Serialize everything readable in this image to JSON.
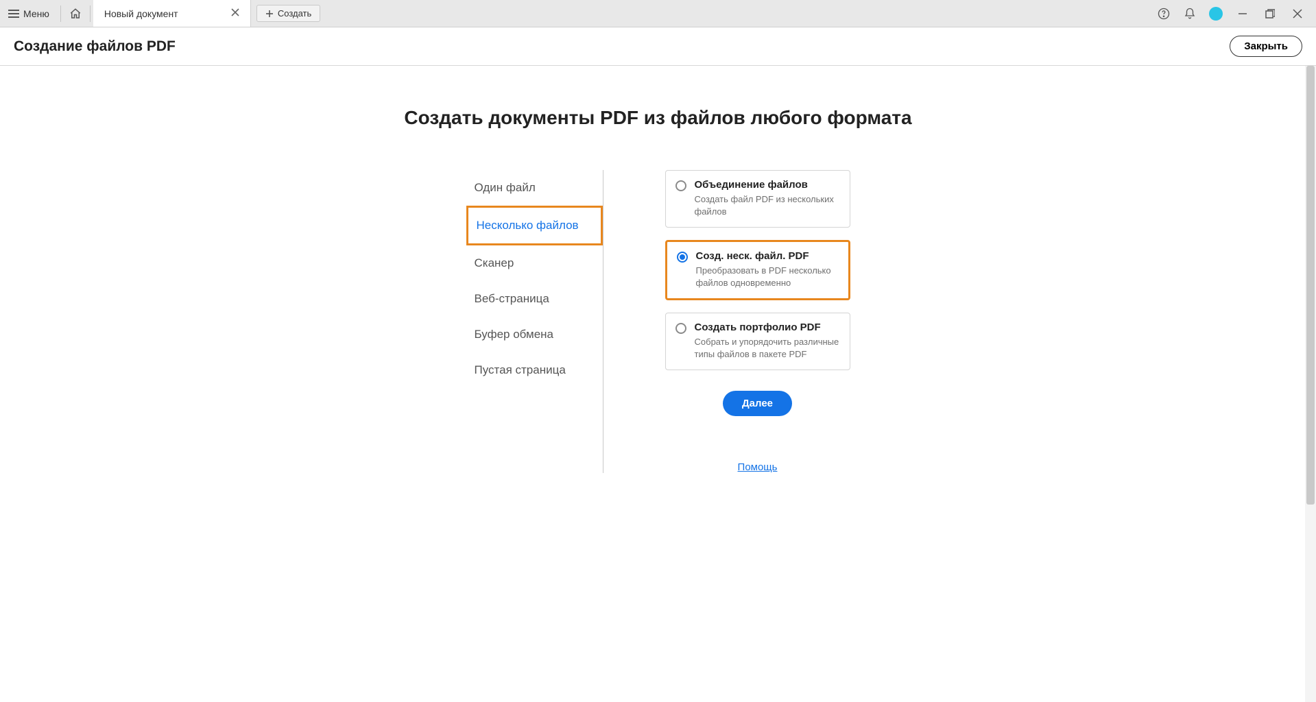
{
  "toolbar": {
    "menu_label": "Меню",
    "tab_label": "Новый документ",
    "create_label": "Создать"
  },
  "header": {
    "title": "Создание файлов PDF",
    "close_label": "Закрыть"
  },
  "main": {
    "title": "Создать документы PDF из файлов любого формата",
    "sidenav": [
      "Один файл",
      "Несколько файлов",
      "Сканер",
      "Веб-страница",
      "Буфер обмена",
      "Пустая страница"
    ],
    "sidenav_active_index": 1,
    "options": [
      {
        "title": "Объединение файлов",
        "desc": "Создать файл PDF из нескольких файлов",
        "selected": false
      },
      {
        "title": "Созд. неск. файл. PDF",
        "desc": "Преобразовать в PDF несколько файлов одновременно",
        "selected": true
      },
      {
        "title": "Создать портфолио PDF",
        "desc": "Собрать и упорядочить различные типы файлов в пакете PDF",
        "selected": false
      }
    ],
    "next_label": "Далее",
    "help_label": "Помощь"
  }
}
